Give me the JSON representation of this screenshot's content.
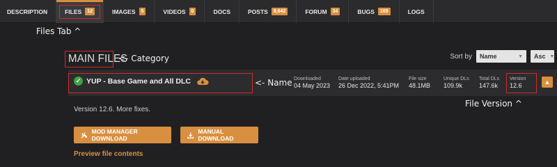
{
  "tabs": [
    {
      "label": "DESCRIPTION",
      "badge": null
    },
    {
      "label": "FILES",
      "badge": "12"
    },
    {
      "label": "IMAGES",
      "badge": "5"
    },
    {
      "label": "VIDEOS",
      "badge": "0"
    },
    {
      "label": "DOCS",
      "badge": null
    },
    {
      "label": "POSTS",
      "badge": "8,642"
    },
    {
      "label": "FORUM",
      "badge": "34"
    },
    {
      "label": "BUGS",
      "badge": "169"
    },
    {
      "label": "LOGS",
      "badge": null
    }
  ],
  "annotations": {
    "files_tab": "Files Tab ^",
    "category": "<- Category",
    "name": "<- Name",
    "file_version": "File Version ^"
  },
  "section": {
    "title": "MAIN FILES"
  },
  "sort": {
    "label": "Sort by",
    "field": "Name",
    "order": "Asc"
  },
  "file": {
    "name": "YUP - Base Game and All DLC",
    "stats": [
      {
        "label": "Downloaded",
        "value": "04 May 2023"
      },
      {
        "label": "Date uploaded",
        "value": "26 Dec 2022, 5:41PM"
      },
      {
        "label": "File size",
        "value": "48.1MB"
      },
      {
        "label": "Unique DLs",
        "value": "109.9k"
      },
      {
        "label": "Total DLs",
        "value": "147.6k"
      },
      {
        "label": "Version",
        "value": "12.6"
      }
    ],
    "description": "Version 12.6. More fixes.",
    "mod_manager_button": "MOD MANAGER DOWNLOAD",
    "manual_button": "MANUAL DOWNLOAD",
    "preview_link": "Preview file contents"
  },
  "colors": {
    "accent": "#d98f40",
    "annotation_box": "#d42a2a",
    "success": "#3fa142"
  }
}
